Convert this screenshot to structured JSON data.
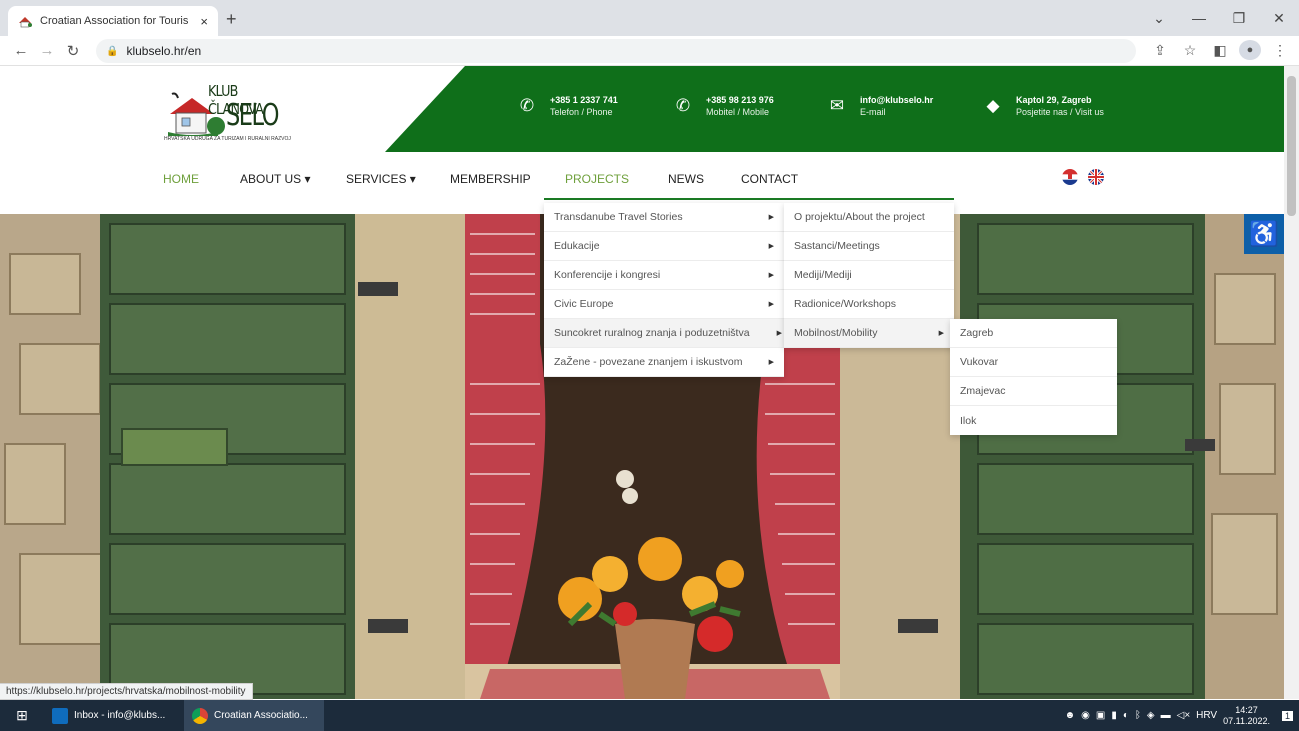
{
  "browser": {
    "tab_title": "Croatian Association for Touris",
    "tab_close": "×",
    "new_tab": "+",
    "url": "klubselo.hr/en",
    "window_controls": [
      "⌄",
      "—",
      "❐",
      "✕"
    ]
  },
  "logo": {
    "line1": "KLUB ČLANOVA",
    "line2": "SELO",
    "tagline": "HRVATSKA UDRUGA ZA TURIZAM I RURALNI RAZVOJ"
  },
  "contacts": [
    {
      "icon": "phone-icon",
      "value": "+385 1 2337 741",
      "label": "Telefon / Phone"
    },
    {
      "icon": "mobile-icon",
      "value": "+385 98 213 976",
      "label": "Mobitel / Mobile"
    },
    {
      "icon": "mail-icon",
      "value": "info@klubselo.hr",
      "label": "E-mail"
    },
    {
      "icon": "directions-icon",
      "value": "Kaptol 29, Zagreb",
      "label": "Posjetite nas / Visit us"
    }
  ],
  "nav": {
    "home": "HOME",
    "about": "ABOUT US ▾",
    "services": "SERVICES ▾",
    "membership": "MEMBERSHIP",
    "projects": "PROJECTS",
    "news": "NEWS",
    "contact": "CONTACT"
  },
  "projects_menu": [
    "Transdanube Travel Stories",
    "Edukacije",
    "Konferencije i kongresi",
    "Civic Europe",
    "Suncokret ruralnog znanja i poduzetništva",
    "ZaŽene - povezane znanjem i iskustvom"
  ],
  "submenu": [
    "O projektu/About the project",
    "Sastanci/Meetings",
    "Mediji/Mediji",
    "Radionice/Workshops",
    "Mobilnost/Mobility"
  ],
  "cities_menu": [
    "Zagreb",
    "Vukovar",
    "Zmajevac",
    "Ilok"
  ],
  "status_url": "https://klubselo.hr/projects/hrvatska/mobilnost-mobility",
  "taskbar": {
    "app1": "Inbox - info@klubs...",
    "app2": "Croatian Associatio...",
    "lang": "HRV",
    "time": "14:27",
    "date": "07.11.2022.",
    "notifications": "1"
  },
  "colors": {
    "green": "#0f6f1a",
    "accent": "#6fa03c",
    "accessibility": "#0d5fa8"
  }
}
